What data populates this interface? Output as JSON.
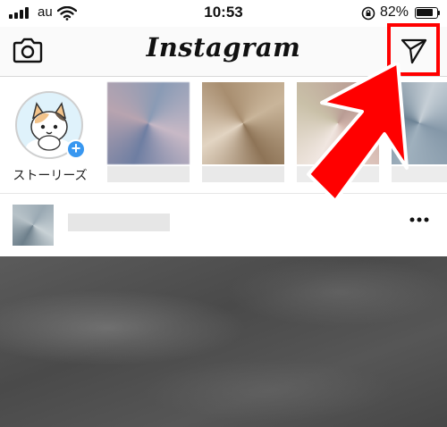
{
  "status_bar": {
    "carrier": "au",
    "time": "10:53",
    "battery_percent": "82%"
  },
  "header": {
    "app_title": "Instagram"
  },
  "stories": {
    "your_story_label": "ストーリーズ"
  },
  "icons": {
    "camera": "camera-icon",
    "direct": "paper-plane-icon",
    "more": "more-options-icon",
    "add": "plus-icon"
  },
  "colors": {
    "accent_blue": "#3897f0",
    "annotation_red": "#ff0000"
  }
}
